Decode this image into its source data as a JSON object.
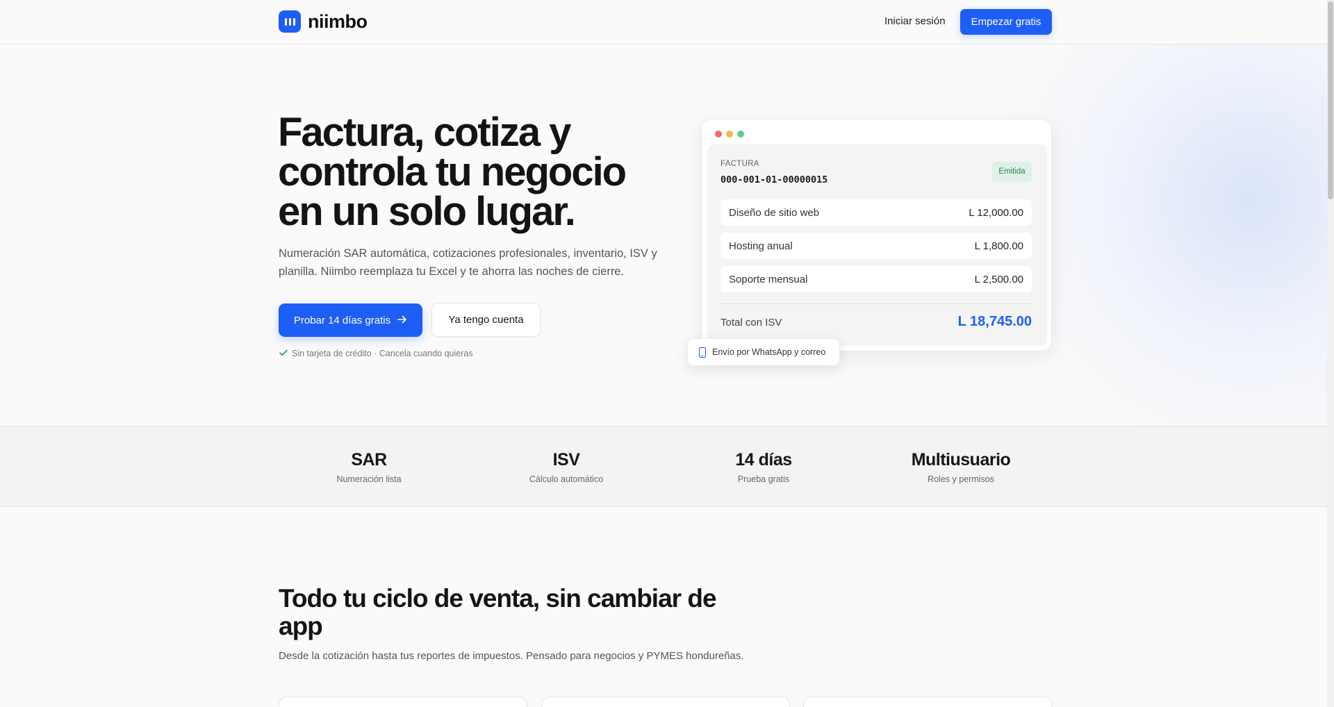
{
  "header": {
    "brand": "niimbo",
    "login": "Iniciar sesión",
    "cta": "Empezar gratis"
  },
  "hero": {
    "title_lines": [
      "Factura, cotiza y",
      "controla tu negocio",
      "en un solo lugar."
    ],
    "subtitle_line1": "Numeración SAR automática, cotizaciones profesionales, inventario, ISV y",
    "subtitle_line2": "planilla. Niimbo reemplaza tu Excel y te ahorra las noches de cierre.",
    "primary_button": "Probar 14 días gratis",
    "secondary_button": "Ya tengo cuenta",
    "note": "Sin tarjeta de crédito · Cancela cuando quieras"
  },
  "invoice": {
    "label": "FACTURA",
    "number": "000-001-01-00000015",
    "status": "Emitida",
    "items": [
      {
        "name": "Diseño de sitio web",
        "amount": "L 12,000.00"
      },
      {
        "name": "Hosting anual",
        "amount": "L 1,800.00"
      },
      {
        "name": "Soporte mensual",
        "amount": "L 2,500.00"
      }
    ],
    "total_label": "Total con ISV",
    "total_value": "L 18,745.00",
    "share_chip": "Envío por WhatsApp y correo"
  },
  "stats": [
    {
      "value": "SAR",
      "label": "Numeración lista"
    },
    {
      "value": "ISV",
      "label": "Cálculo automático"
    },
    {
      "value": "14 días",
      "label": "Prueba gratis"
    },
    {
      "value": "Multiusuario",
      "label": "Roles y permisos"
    }
  ],
  "section": {
    "title_line1": "Todo tu ciclo de venta, sin cambiar de",
    "title_line2": "app",
    "subtitle": "Desde la cotización hasta tus reportes de impuestos. Pensado para negocios y PYMES hondureñas."
  },
  "colors": {
    "accent": "#1d5ef5",
    "status_green": "#1f8a4c",
    "dot_red": "#f26b6b",
    "dot_yellow": "#f5b84a",
    "dot_green": "#5fcf8a"
  },
  "icons": [
    "logo-mark-icon",
    "arrow-right-icon",
    "check-icon",
    "phone-icon"
  ]
}
